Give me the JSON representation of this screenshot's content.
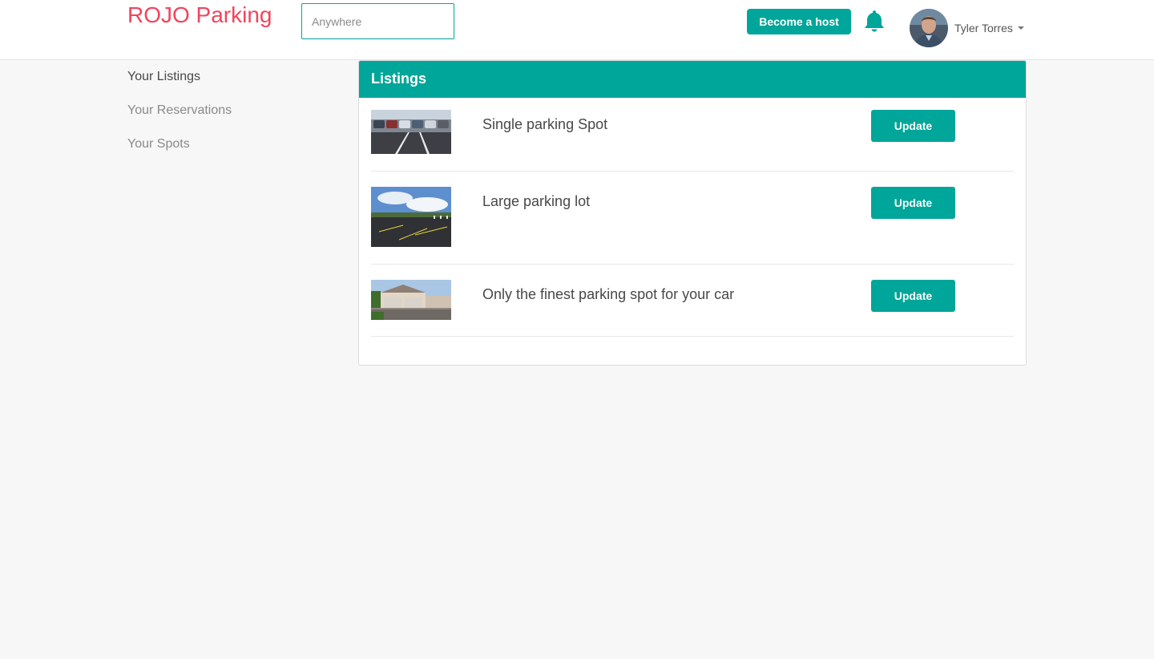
{
  "header": {
    "brand": "ROJO Parking",
    "search_placeholder": "Anywhere",
    "host_button": "Become a host",
    "bell_icon": "bell-icon",
    "user_name": "Tyler Torres",
    "accent_color": "#00a699",
    "brand_color": "#f2445c"
  },
  "sidebar": {
    "items": [
      {
        "label": "Your Listings",
        "active": true
      },
      {
        "label": "Your Reservations",
        "active": false
      },
      {
        "label": "Your Spots",
        "active": false
      }
    ]
  },
  "listings": {
    "title": "Listings",
    "items": [
      {
        "title": "Single parking Spot",
        "button": "Update"
      },
      {
        "title": "Large parking lot",
        "button": "Update"
      },
      {
        "title": "Only the finest parking spot for your car",
        "button": "Update"
      }
    ]
  }
}
